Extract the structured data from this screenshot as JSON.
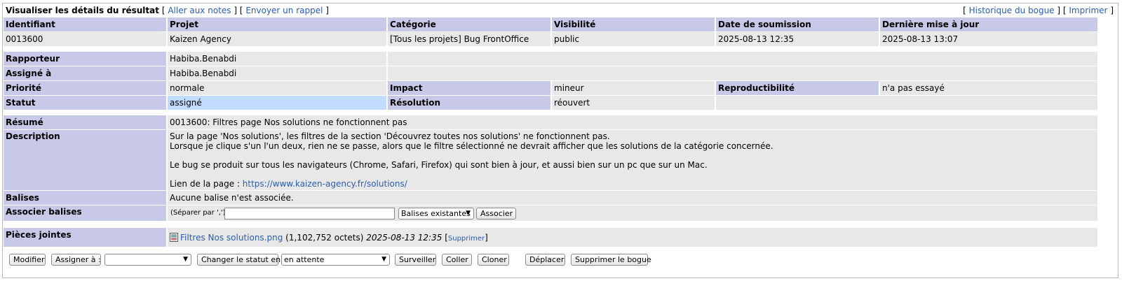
{
  "header": {
    "title": "Visualiser les détails du résultat",
    "links_left": [
      "Aller aux notes",
      "Envoyer un rappel"
    ],
    "links_right": [
      "Historique du bogue",
      "Imprimer"
    ]
  },
  "summary_table": {
    "columns": [
      "Identifiant",
      "Projet",
      "Catégorie",
      "Visibilité",
      "Date de soumission",
      "Dernière mise à jour"
    ],
    "values": [
      "0013600",
      "Kaizen Agency",
      "[Tous les projets] Bug FrontOffice",
      "public",
      "2025-08-13 12:35",
      "2025-08-13 13:07"
    ]
  },
  "details": {
    "reporter_label": "Rapporteur",
    "reporter": "Habiba.Benabdi",
    "assigned_label": "Assigné à",
    "assigned": "Habiba.Benabdi",
    "priority_label": "Priorité",
    "priority": "normale",
    "impact_label": "Impact",
    "impact": "mineur",
    "repro_label": "Reproductibilité",
    "repro": "n'a pas essayé",
    "status_label": "Statut",
    "status": "assigné",
    "resolution_label": "Résolution",
    "resolution": "réouvert"
  },
  "issue": {
    "summary_label": "Résumé",
    "summary": "0013600: Filtres page Nos solutions ne fonctionnent pas",
    "description_label": "Description",
    "description_lines": [
      "Sur la page 'Nos solutions', les filtres de la section 'Découvrez toutes nos solutions' ne fonctionnent pas.",
      "Lorsque je clique s'un l'un deux, rien ne se passe, alors que le filtre sélectionné ne devrait afficher que les solutions de la catégorie concernée.",
      "",
      "Le bug se produit sur tous les navigateurs (Chrome, Safari, Firefox) qui sont bien à jour, et aussi bien sur un pc que sur un Mac."
    ],
    "link_prefix": "Lien de la page : ",
    "link_url": "https://www.kaizen-agency.fr/solutions/",
    "tags_label": "Balises",
    "tags_value": "Aucune balise n'est associée.",
    "assoc_label": "Associer balises",
    "assoc_hint": "(Séparer par ',')",
    "assoc_input_value": "",
    "assoc_select": "Balises existantes",
    "assoc_button": "Associer"
  },
  "attachments": {
    "label": "Pièces jointes",
    "file_name": "Filtres Nos solutions.png",
    "file_size": "(1,102,752 octets)",
    "file_date": "2025-08-13 12:35",
    "delete_link": "Supprimer"
  },
  "actions": {
    "edit": "Modifier",
    "assign_to": "Assigner à :",
    "assign_select": "",
    "change_status": "Changer le statut en:",
    "status_select": "en attente",
    "monitor": "Surveiller",
    "stick": "Coller",
    "clone": "Cloner",
    "move": "Déplacer",
    "delete_bug": "Supprimer le bogue"
  },
  "icons": {
    "attachment": "image-file-icon",
    "dropdown": "chevron-down-icon"
  }
}
